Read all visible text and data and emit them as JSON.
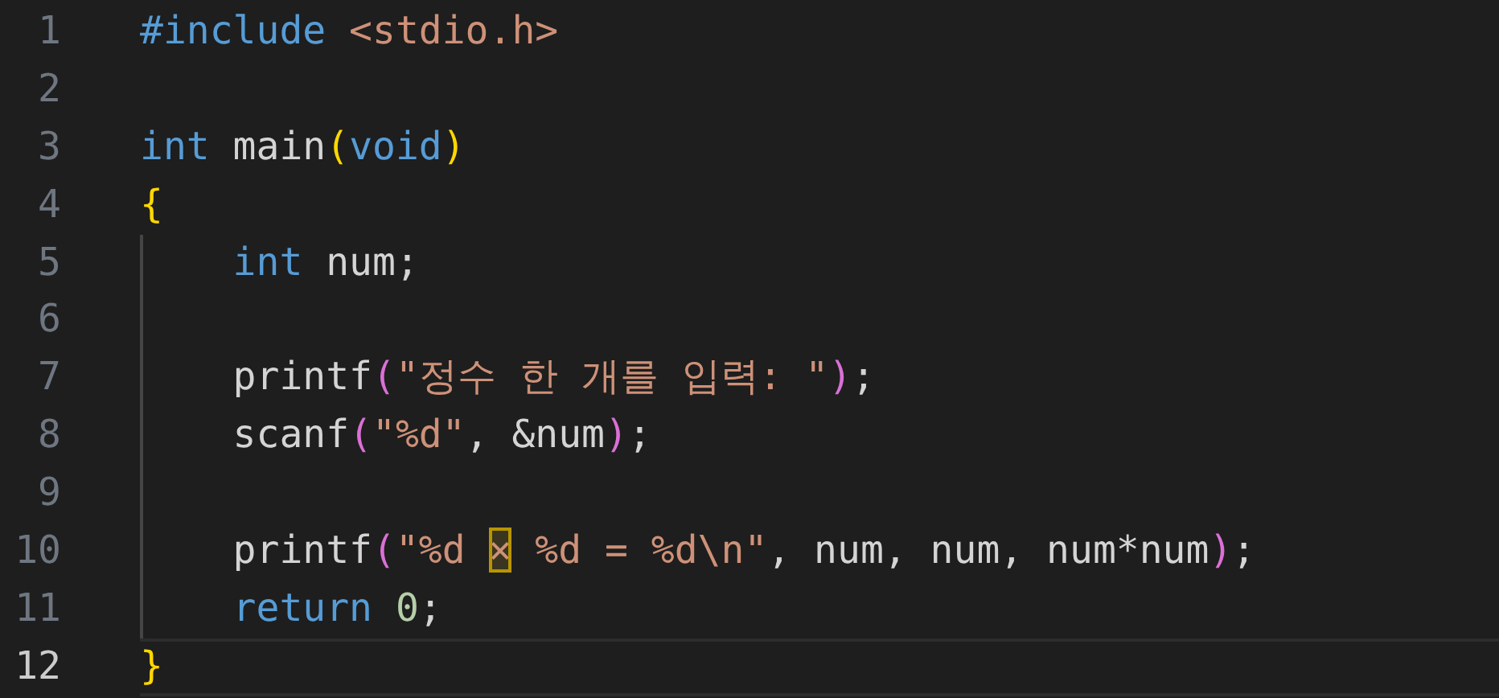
{
  "editor": {
    "lines": [
      {
        "number": "1",
        "selected": false,
        "guide": false,
        "tokens": [
          {
            "text": "#include",
            "kind": "keyword"
          },
          {
            "text": " <stdio.h>",
            "kind": "string"
          }
        ]
      },
      {
        "number": "2",
        "selected": false,
        "guide": false
      },
      {
        "number": "3",
        "selected": false,
        "guide": false,
        "tokens": [
          {
            "text": "int",
            "kind": "keyword"
          },
          {
            "text": " main",
            "kind": "plain"
          },
          {
            "text": "(",
            "kind": "bracket1"
          },
          {
            "text": "void",
            "kind": "keyword"
          },
          {
            "text": ")",
            "kind": "bracket1"
          }
        ]
      },
      {
        "number": "4",
        "selected": false,
        "guide": false,
        "tokens": [
          {
            "text": "{",
            "kind": "bracket1"
          }
        ]
      },
      {
        "number": "5",
        "selected": false,
        "guide": true,
        "tokens": [
          {
            "text": "    int",
            "kind": "keyword"
          },
          {
            "text": " num;",
            "kind": "plain"
          }
        ]
      },
      {
        "number": "6",
        "selected": false,
        "guide": true
      },
      {
        "number": "7",
        "selected": false,
        "guide": true,
        "tokens": [
          {
            "text": "    printf",
            "kind": "plain"
          },
          {
            "text": "(",
            "kind": "bracket2"
          },
          {
            "text": "\"정수 한 개를 입력: \"",
            "kind": "string"
          },
          {
            "text": ")",
            "kind": "bracket2"
          },
          {
            "text": ";",
            "kind": "plain"
          }
        ]
      },
      {
        "number": "8",
        "selected": false,
        "guide": true,
        "tokens": [
          {
            "text": "    scanf",
            "kind": "plain"
          },
          {
            "text": "(",
            "kind": "bracket2"
          },
          {
            "text": "\"%d\"",
            "kind": "string"
          },
          {
            "text": ", &num",
            "kind": "plain"
          },
          {
            "text": ")",
            "kind": "bracket2"
          },
          {
            "text": ";",
            "kind": "plain"
          }
        ]
      },
      {
        "number": "9",
        "selected": false,
        "guide": true
      },
      {
        "number": "10",
        "selected": false,
        "guide": true,
        "tokens": [
          {
            "text": "    printf",
            "kind": "plain"
          },
          {
            "text": "(",
            "kind": "bracket2"
          },
          {
            "text": "\"%d ",
            "kind": "string"
          },
          {
            "text": "×",
            "kind": "highlight"
          },
          {
            "text": " %d = %d\\n\"",
            "kind": "string"
          },
          {
            "text": ", num, num, num*num",
            "kind": "plain"
          },
          {
            "text": ")",
            "kind": "bracket2"
          },
          {
            "text": ";",
            "kind": "plain"
          }
        ]
      },
      {
        "number": "11",
        "selected": false,
        "guide": true,
        "tokens": [
          {
            "text": "    return",
            "kind": "keyword"
          },
          {
            "text": " 0",
            "kind": "number"
          },
          {
            "text": ";",
            "kind": "plain"
          }
        ]
      },
      {
        "number": "12",
        "selected": true,
        "guide": false,
        "tokens": [
          {
            "text": "}",
            "kind": "bracket1"
          }
        ]
      }
    ]
  }
}
